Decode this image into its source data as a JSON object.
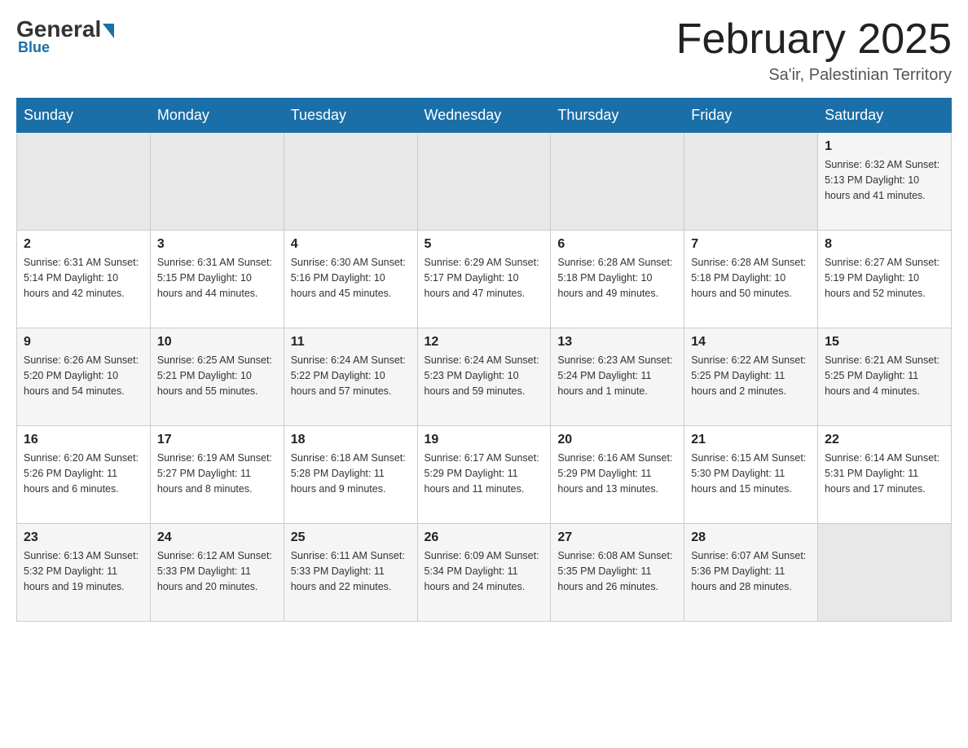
{
  "header": {
    "logo": {
      "general": "General",
      "blue": "Blue"
    },
    "title": "February 2025",
    "location": "Sa'ir, Palestinian Territory"
  },
  "weekdays": [
    "Sunday",
    "Monday",
    "Tuesday",
    "Wednesday",
    "Thursday",
    "Friday",
    "Saturday"
  ],
  "weeks": [
    [
      {
        "day": "",
        "info": ""
      },
      {
        "day": "",
        "info": ""
      },
      {
        "day": "",
        "info": ""
      },
      {
        "day": "",
        "info": ""
      },
      {
        "day": "",
        "info": ""
      },
      {
        "day": "",
        "info": ""
      },
      {
        "day": "1",
        "info": "Sunrise: 6:32 AM\nSunset: 5:13 PM\nDaylight: 10 hours and 41 minutes."
      }
    ],
    [
      {
        "day": "2",
        "info": "Sunrise: 6:31 AM\nSunset: 5:14 PM\nDaylight: 10 hours and 42 minutes."
      },
      {
        "day": "3",
        "info": "Sunrise: 6:31 AM\nSunset: 5:15 PM\nDaylight: 10 hours and 44 minutes."
      },
      {
        "day": "4",
        "info": "Sunrise: 6:30 AM\nSunset: 5:16 PM\nDaylight: 10 hours and 45 minutes."
      },
      {
        "day": "5",
        "info": "Sunrise: 6:29 AM\nSunset: 5:17 PM\nDaylight: 10 hours and 47 minutes."
      },
      {
        "day": "6",
        "info": "Sunrise: 6:28 AM\nSunset: 5:18 PM\nDaylight: 10 hours and 49 minutes."
      },
      {
        "day": "7",
        "info": "Sunrise: 6:28 AM\nSunset: 5:18 PM\nDaylight: 10 hours and 50 minutes."
      },
      {
        "day": "8",
        "info": "Sunrise: 6:27 AM\nSunset: 5:19 PM\nDaylight: 10 hours and 52 minutes."
      }
    ],
    [
      {
        "day": "9",
        "info": "Sunrise: 6:26 AM\nSunset: 5:20 PM\nDaylight: 10 hours and 54 minutes."
      },
      {
        "day": "10",
        "info": "Sunrise: 6:25 AM\nSunset: 5:21 PM\nDaylight: 10 hours and 55 minutes."
      },
      {
        "day": "11",
        "info": "Sunrise: 6:24 AM\nSunset: 5:22 PM\nDaylight: 10 hours and 57 minutes."
      },
      {
        "day": "12",
        "info": "Sunrise: 6:24 AM\nSunset: 5:23 PM\nDaylight: 10 hours and 59 minutes."
      },
      {
        "day": "13",
        "info": "Sunrise: 6:23 AM\nSunset: 5:24 PM\nDaylight: 11 hours and 1 minute."
      },
      {
        "day": "14",
        "info": "Sunrise: 6:22 AM\nSunset: 5:25 PM\nDaylight: 11 hours and 2 minutes."
      },
      {
        "day": "15",
        "info": "Sunrise: 6:21 AM\nSunset: 5:25 PM\nDaylight: 11 hours and 4 minutes."
      }
    ],
    [
      {
        "day": "16",
        "info": "Sunrise: 6:20 AM\nSunset: 5:26 PM\nDaylight: 11 hours and 6 minutes."
      },
      {
        "day": "17",
        "info": "Sunrise: 6:19 AM\nSunset: 5:27 PM\nDaylight: 11 hours and 8 minutes."
      },
      {
        "day": "18",
        "info": "Sunrise: 6:18 AM\nSunset: 5:28 PM\nDaylight: 11 hours and 9 minutes."
      },
      {
        "day": "19",
        "info": "Sunrise: 6:17 AM\nSunset: 5:29 PM\nDaylight: 11 hours and 11 minutes."
      },
      {
        "day": "20",
        "info": "Sunrise: 6:16 AM\nSunset: 5:29 PM\nDaylight: 11 hours and 13 minutes."
      },
      {
        "day": "21",
        "info": "Sunrise: 6:15 AM\nSunset: 5:30 PM\nDaylight: 11 hours and 15 minutes."
      },
      {
        "day": "22",
        "info": "Sunrise: 6:14 AM\nSunset: 5:31 PM\nDaylight: 11 hours and 17 minutes."
      }
    ],
    [
      {
        "day": "23",
        "info": "Sunrise: 6:13 AM\nSunset: 5:32 PM\nDaylight: 11 hours and 19 minutes."
      },
      {
        "day": "24",
        "info": "Sunrise: 6:12 AM\nSunset: 5:33 PM\nDaylight: 11 hours and 20 minutes."
      },
      {
        "day": "25",
        "info": "Sunrise: 6:11 AM\nSunset: 5:33 PM\nDaylight: 11 hours and 22 minutes."
      },
      {
        "day": "26",
        "info": "Sunrise: 6:09 AM\nSunset: 5:34 PM\nDaylight: 11 hours and 24 minutes."
      },
      {
        "day": "27",
        "info": "Sunrise: 6:08 AM\nSunset: 5:35 PM\nDaylight: 11 hours and 26 minutes."
      },
      {
        "day": "28",
        "info": "Sunrise: 6:07 AM\nSunset: 5:36 PM\nDaylight: 11 hours and 28 minutes."
      },
      {
        "day": "",
        "info": ""
      }
    ]
  ]
}
